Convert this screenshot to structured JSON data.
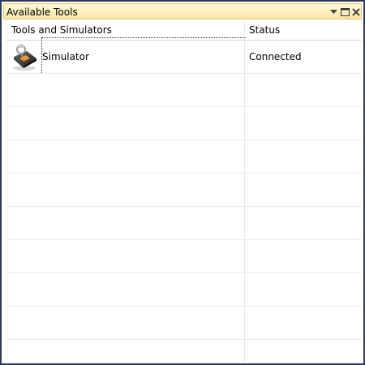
{
  "window": {
    "title": "Available Tools",
    "buttons": {
      "menu": "dropdown-icon",
      "maximize": "maximize-icon",
      "close": "close-icon"
    }
  },
  "table": {
    "columns": [
      "Tools and Simulators",
      "Status"
    ],
    "rows": [
      {
        "icon": "simulator-icon",
        "name": "Simulator",
        "status": "Connected"
      }
    ],
    "empty_rows": 8
  },
  "colors": {
    "frame": "#2b3a55",
    "title_bg": "#fbe7a4",
    "title_border": "#e6c36b",
    "grid_line": "#eaeaea"
  }
}
